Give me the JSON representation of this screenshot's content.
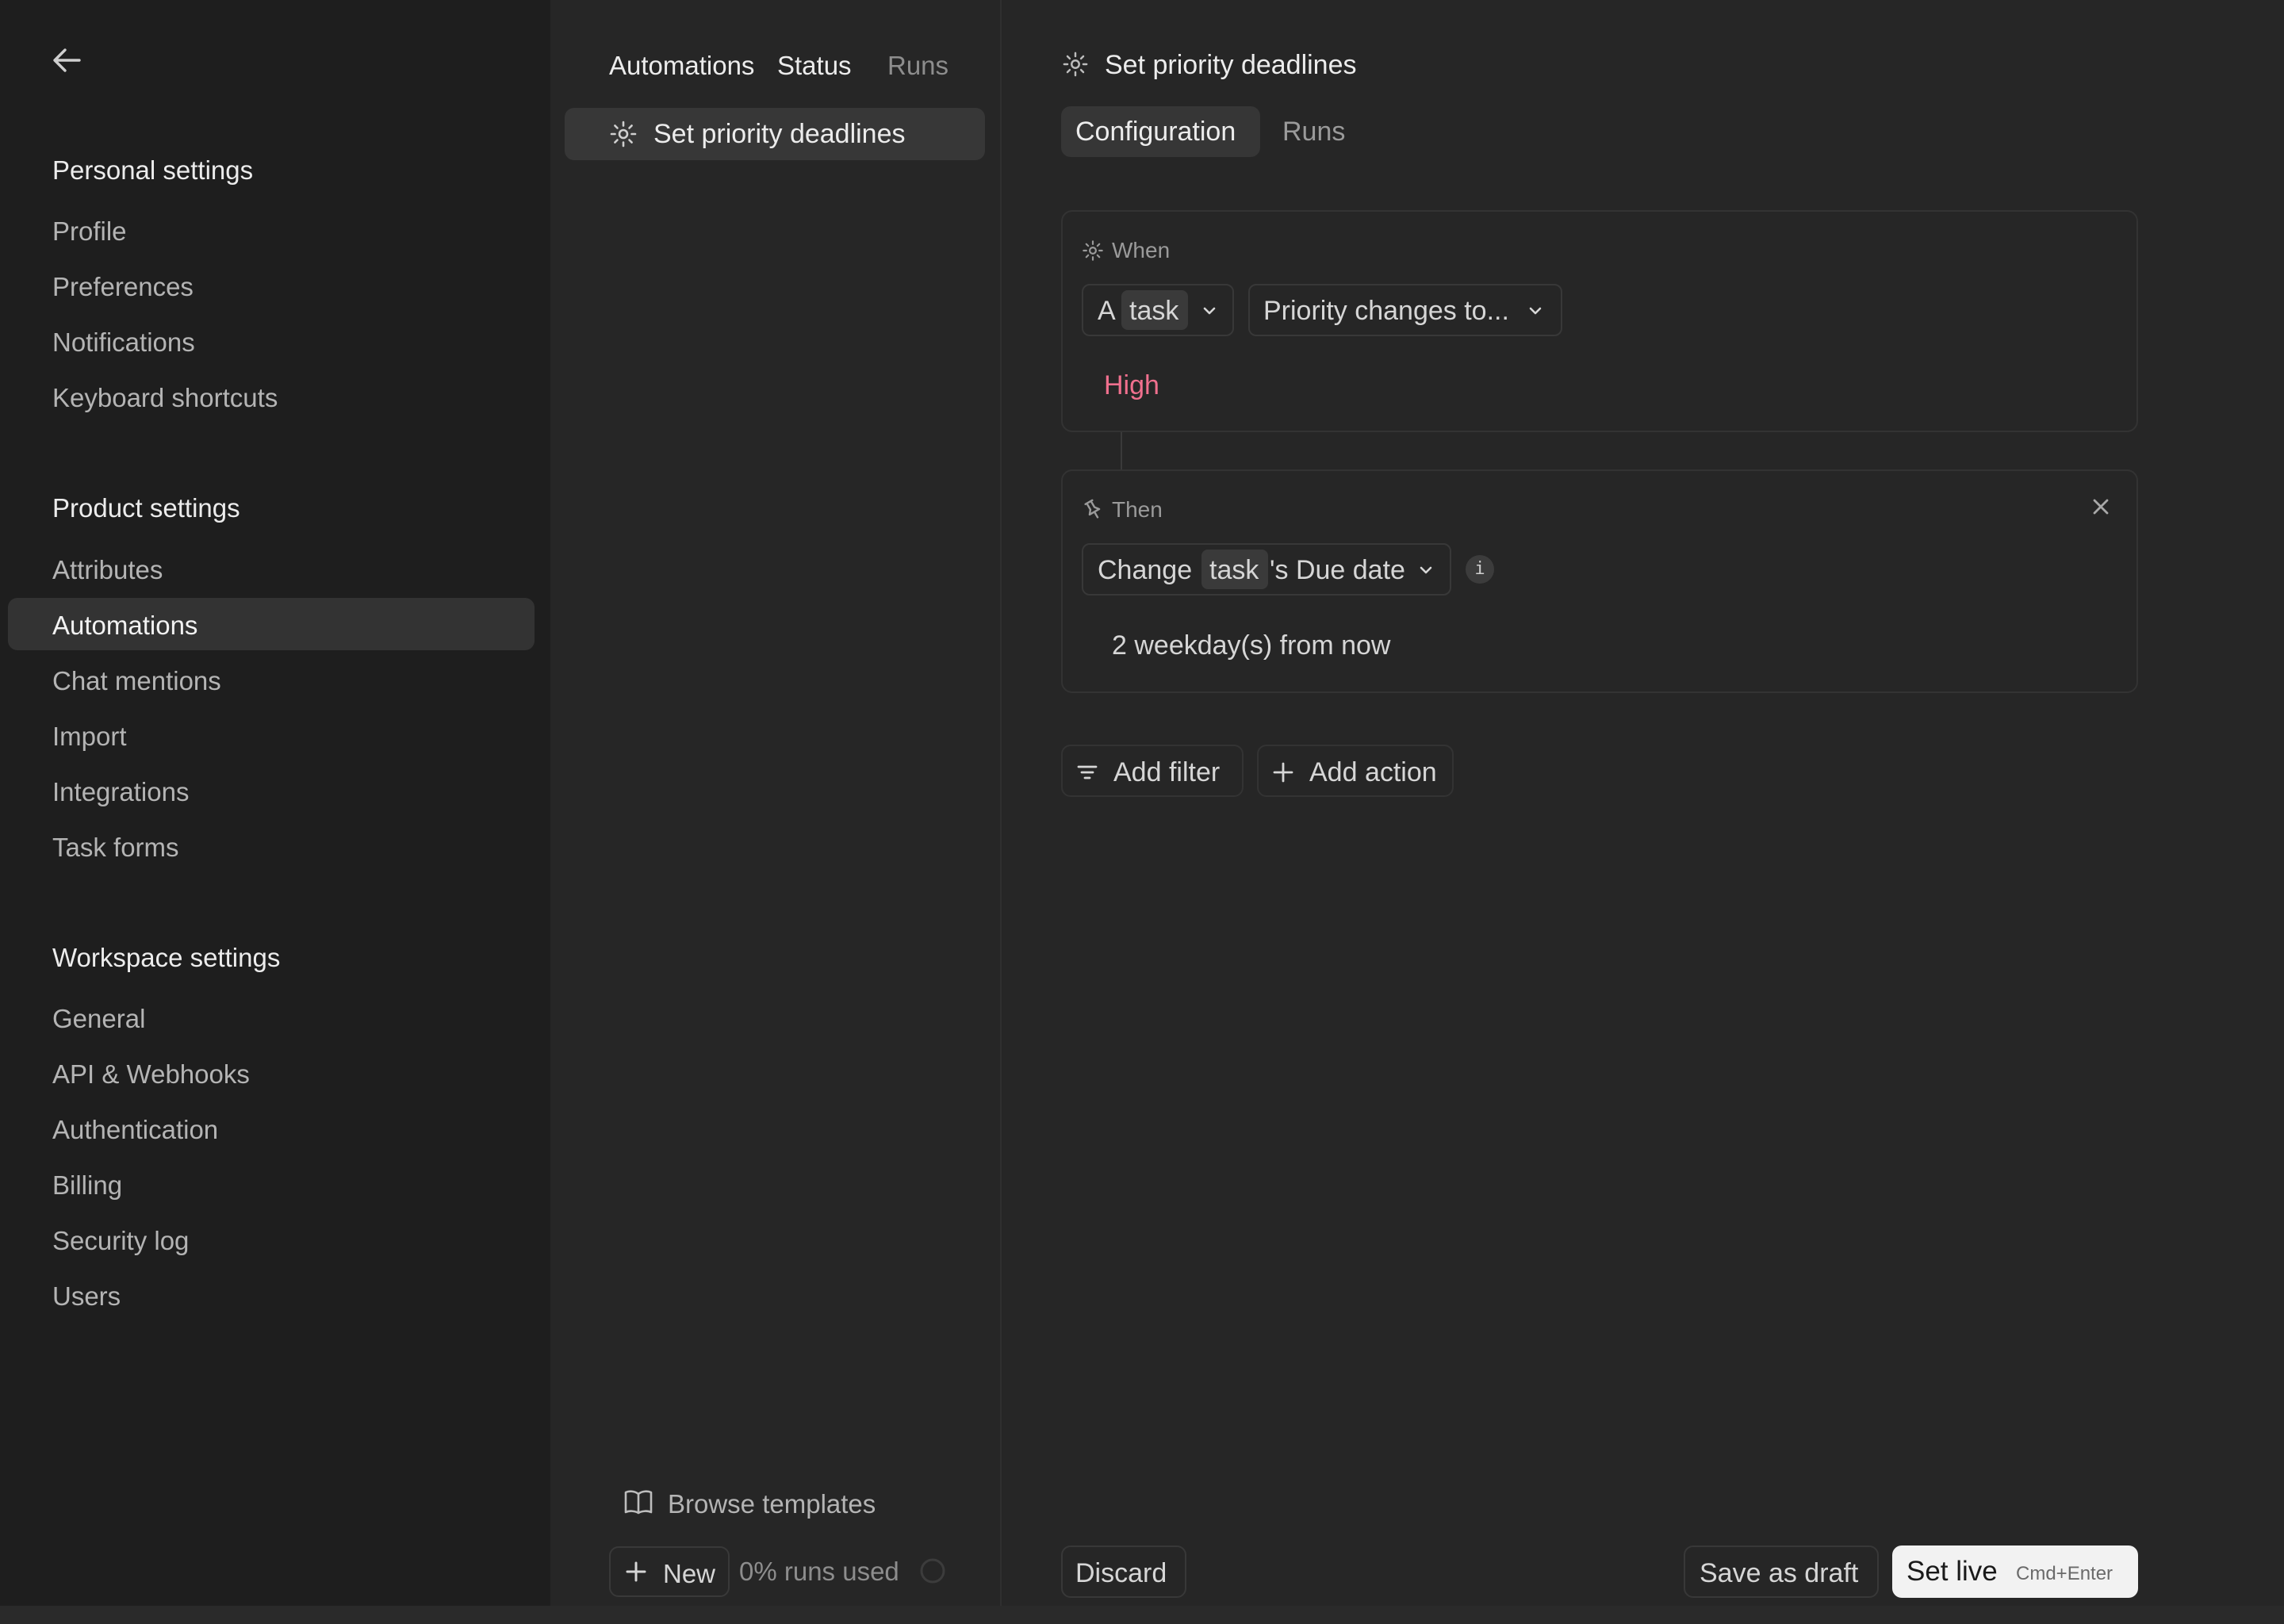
{
  "sidebar": {
    "sections": [
      {
        "title": "Personal settings",
        "items": [
          "Profile",
          "Preferences",
          "Notifications",
          "Keyboard shortcuts"
        ]
      },
      {
        "title": "Product settings",
        "items": [
          "Attributes",
          "Automations",
          "Chat mentions",
          "Import",
          "Integrations",
          "Task forms"
        ]
      },
      {
        "title": "Workspace settings",
        "items": [
          "General",
          "API & Webhooks",
          "Authentication",
          "Billing",
          "Security log",
          "Users"
        ]
      }
    ],
    "active_item": "Automations"
  },
  "list_panel": {
    "tabs": [
      "Automations",
      "Status",
      "Runs"
    ],
    "items": [
      "Set priority deadlines"
    ],
    "browse_templates": "Browse templates",
    "new_label": "New",
    "runs_used": "0% runs used",
    "runs_used_fraction": 0
  },
  "editor": {
    "title": "Set priority deadlines",
    "tabs": [
      "Configuration",
      "Runs"
    ],
    "active_tab": "Configuration",
    "when": {
      "label": "When",
      "subject_prefix": "A",
      "subject_chip": "task",
      "condition": "Priority changes to...",
      "value": "High",
      "value_color": "#f0708e"
    },
    "then": {
      "label": "Then",
      "action_prefix": "Change",
      "action_chip": "task",
      "action_suffix": "'s Due date",
      "info": "i",
      "value": "2 weekday(s) from now"
    },
    "add_filter": "Add filter",
    "add_action": "Add action"
  },
  "footer": {
    "discard": "Discard",
    "save_draft": "Save as draft",
    "set_live": "Set live",
    "set_live_shortcut": "Cmd+Enter"
  }
}
